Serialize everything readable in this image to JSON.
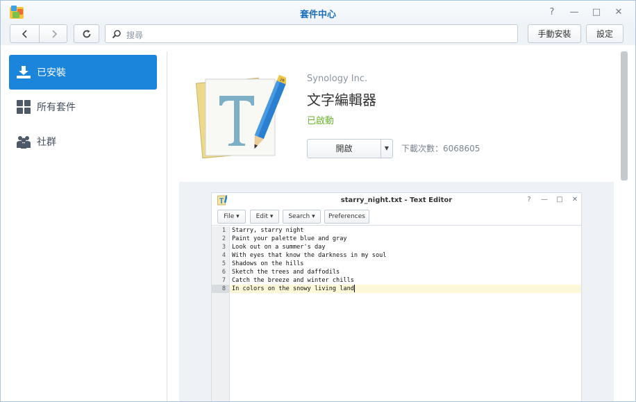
{
  "window": {
    "title": "套件中心",
    "controls": {
      "help": "?",
      "minimize": "—",
      "maximize": "□",
      "close": "✕"
    }
  },
  "toolbar": {
    "search_placeholder": "搜尋",
    "manual_install_label": "手動安裝",
    "settings_label": "設定"
  },
  "sidebar": {
    "items": [
      {
        "label": "已安裝",
        "icon": "download-icon",
        "active": true
      },
      {
        "label": "所有套件",
        "icon": "grid-icon",
        "active": false
      },
      {
        "label": "社群",
        "icon": "community-icon",
        "active": false
      }
    ]
  },
  "package": {
    "vendor": "Synology Inc.",
    "name": "文字編輯器",
    "status": "已啟動",
    "open_label": "開啟",
    "downloads": "下載次數：6068605",
    "icon": "text-editor-app-icon"
  },
  "screenshot": {
    "title": "starry_night.txt - Text Editor",
    "controls": {
      "help": "?",
      "minimize": "—",
      "maximize": "□",
      "close": "✕"
    },
    "menu": [
      "File ▾",
      "Edit ▾",
      "Search ▾",
      "Preferences"
    ],
    "lines": [
      {
        "n": "1",
        "text": "Starry, starry night"
      },
      {
        "n": "2",
        "text": "Paint your palette blue and gray"
      },
      {
        "n": "3",
        "text": "Look out on a summer's day"
      },
      {
        "n": "4",
        "text": "With eyes that know the darkness in my soul"
      },
      {
        "n": "5",
        "text": "Shadows on the hills"
      },
      {
        "n": "6",
        "text": "Sketch the trees and daffodils"
      },
      {
        "n": "7",
        "text": "Catch the breeze and winter chills"
      },
      {
        "n": "8",
        "text": "In colors on the snowy living land"
      }
    ]
  },
  "colors": {
    "accent": "#1b85dc",
    "title": "#1a6fb8",
    "status_ok": "#6ab42d"
  }
}
